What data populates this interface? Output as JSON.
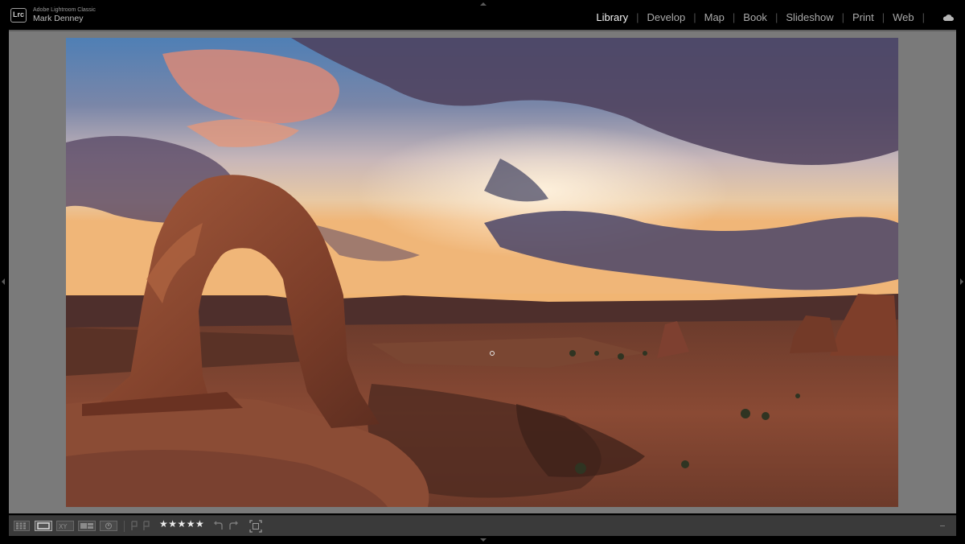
{
  "app": {
    "logo_text": "Lrc",
    "product_name": "Adobe Lightroom Classic",
    "user_name": "Mark Denney"
  },
  "modules": [
    {
      "label": "Library",
      "active": true
    },
    {
      "label": "Develop",
      "active": false
    },
    {
      "label": "Map",
      "active": false
    },
    {
      "label": "Book",
      "active": false
    },
    {
      "label": "Slideshow",
      "active": false
    },
    {
      "label": "Print",
      "active": false
    },
    {
      "label": "Web",
      "active": false
    }
  ],
  "module_separator": "|",
  "photo": {
    "subject": "Sandstone arch over canyon at sunset"
  },
  "toolbar": {
    "view_modes": [
      "grid-view-icon",
      "loupe-view-icon",
      "compare-view-icon",
      "survey-view-icon",
      "people-view-icon"
    ],
    "active_view": "loupe-view-icon",
    "rating_stars": "★★★★★",
    "rating": 5
  },
  "colors": {
    "background": "#7a7a7a",
    "topbar": "#000000",
    "toolbar": "#3a3a3a",
    "active_module": "#f2f2f2",
    "inactive_module": "#a9a9a9"
  }
}
